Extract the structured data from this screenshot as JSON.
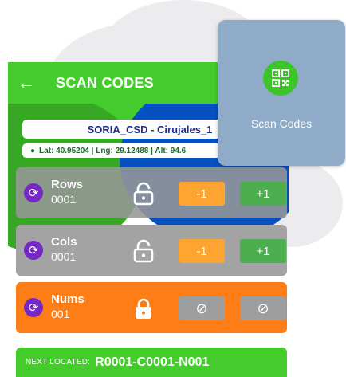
{
  "appbar": {
    "back_icon": "arrow-left-icon",
    "title": "SCAN CODES"
  },
  "location": {
    "name": "SORIA_CSD - Cirujales_1",
    "coords": "Lat: 40.95204 | Lng: 29.12488 | Alt: 94.6"
  },
  "counters": [
    {
      "label": "Rows",
      "value": "0001",
      "locked": false,
      "minus": "-1",
      "plus": "+1"
    },
    {
      "label": "Cols",
      "value": "0001",
      "locked": false,
      "minus": "-1",
      "plus": "+1"
    },
    {
      "label": "Nums",
      "value": "001",
      "locked": true,
      "minus_icon": "block-icon",
      "plus_icon": "block-icon"
    }
  ],
  "next": {
    "label": "NEXT LOCATED:",
    "value": "R0001-C0001-N001"
  },
  "tooltip": {
    "label": "Scan Codes",
    "icon": "qr-code-icon"
  },
  "colors": {
    "appbar": "#43cc2c",
    "blue_overlay": "#0750c0",
    "orange_row": "#ff7d16",
    "minus_button": "#ffa431",
    "plus_button": "#4cae4f",
    "sync_icon": "#7428c4",
    "tooltip": "#8fabc7"
  }
}
